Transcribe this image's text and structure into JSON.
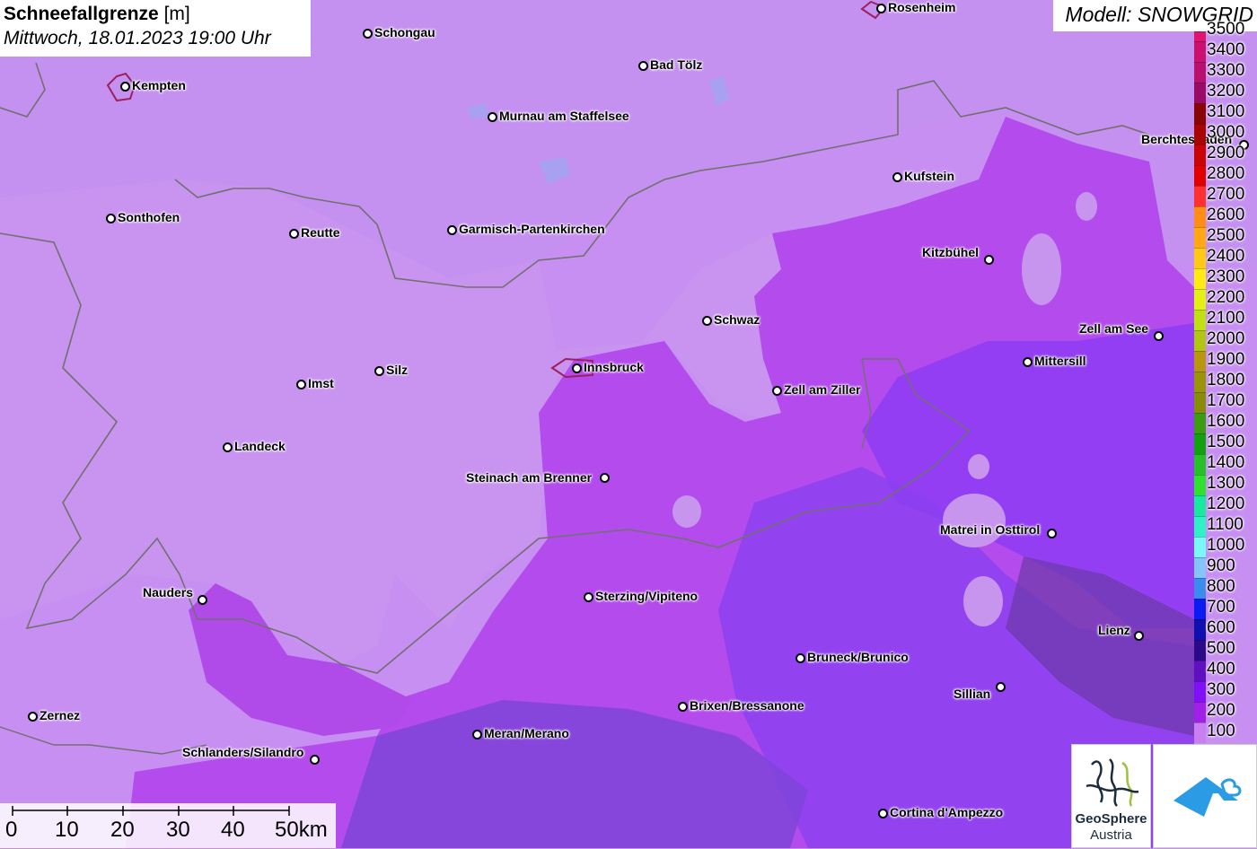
{
  "title": {
    "main": "Schneefallgrenze",
    "unit": "[m]",
    "datetime": "Mittwoch, 18.01.2023 19:00 Uhr"
  },
  "model": "Modell: SNOWGRID",
  "legend": {
    "labels": [
      "3500",
      "3400",
      "3300",
      "3200",
      "3100",
      "3000",
      "2900",
      "2800",
      "2700",
      "2600",
      "2500",
      "2400",
      "2300",
      "2200",
      "2100",
      "2000",
      "1900",
      "1800",
      "1700",
      "1600",
      "1500",
      "1400",
      "1300",
      "1200",
      "1100",
      "1000",
      "900",
      "800",
      "700",
      "600",
      "500",
      "400",
      "300",
      "200",
      "100"
    ],
    "colors": [
      "#e0156f",
      "#cc1070",
      "#b8106e",
      "#9c0a68",
      "#8a0606",
      "#a80404",
      "#c80404",
      "#e00000",
      "#ff3030",
      "#ff8c14",
      "#ffa814",
      "#ffc814",
      "#ffea14",
      "#e2f014",
      "#c0e014",
      "#b2c414",
      "#b89610",
      "#9c9408",
      "#888c08",
      "#3c9c10",
      "#10a010",
      "#28c028",
      "#30e030",
      "#18e8a0",
      "#30f0c8",
      "#78f8f8",
      "#84c4f8",
      "#3c8cf0",
      "#0c1cf0",
      "#1010b0",
      "#2a0a88",
      "#6010c0",
      "#8010f8",
      "#a020e8",
      "#c880f0"
    ]
  },
  "cities": [
    {
      "name": "Rosenheim"
    },
    {
      "name": "Schongau"
    },
    {
      "name": "Bad Tölz"
    },
    {
      "name": "Kempten"
    },
    {
      "name": "Murnau am Staffelsee"
    },
    {
      "name": "Berchtesgaden"
    },
    {
      "name": "Kufstein"
    },
    {
      "name": "Sonthofen"
    },
    {
      "name": "Reutte"
    },
    {
      "name": "Garmisch-Partenkirchen"
    },
    {
      "name": "Kitzbühel"
    },
    {
      "name": "Schwaz"
    },
    {
      "name": "Zell am See"
    },
    {
      "name": "Mittersill"
    },
    {
      "name": "Innsbruck"
    },
    {
      "name": "Silz"
    },
    {
      "name": "Imst"
    },
    {
      "name": "Zell am Ziller"
    },
    {
      "name": "Landeck"
    },
    {
      "name": "Steinach am Brenner"
    },
    {
      "name": "Matrei in Osttirol"
    },
    {
      "name": "Nauders"
    },
    {
      "name": "Sterzing/Vipiteno"
    },
    {
      "name": "Lienz"
    },
    {
      "name": "Bruneck/Brunico"
    },
    {
      "name": "Sillian"
    },
    {
      "name": "Brixen/Bressanone"
    },
    {
      "name": "Zernez"
    },
    {
      "name": "Meran/Merano"
    },
    {
      "name": "Schlanders/Silandro"
    },
    {
      "name": "Cortina d'Ampezzo"
    }
  ],
  "scale": {
    "labels": [
      "0",
      "10",
      "20",
      "30",
      "40",
      "50km"
    ]
  },
  "logos": {
    "geosphere_name": "GeoSphere",
    "geosphere_sub": "Austria"
  }
}
